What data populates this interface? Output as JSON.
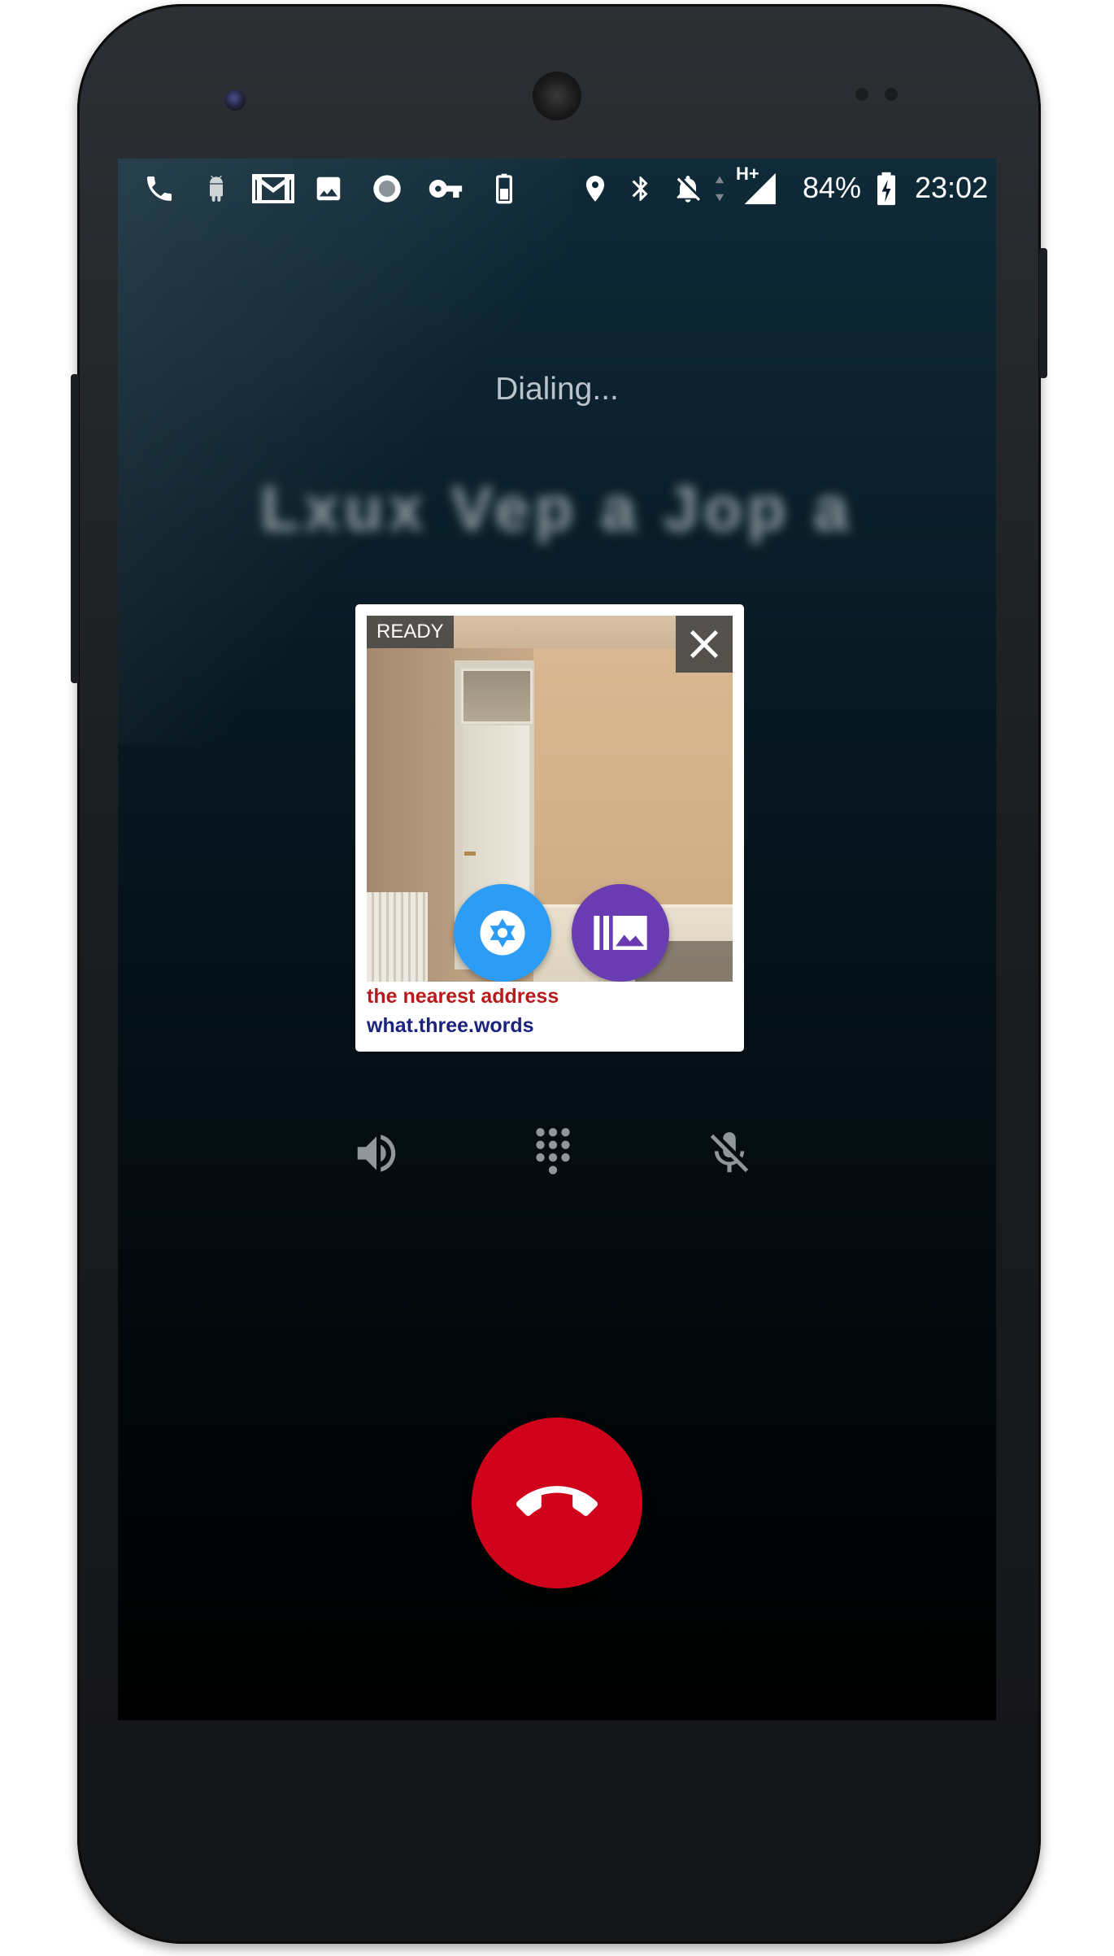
{
  "device": {
    "model": "phone"
  },
  "status_bar": {
    "icons": [
      "phone-icon",
      "android-icon",
      "gmail-icon",
      "image-icon",
      "record-icon",
      "key-icon",
      "battery-saver-icon",
      "location-icon",
      "bluetooth-icon",
      "notifications-off-icon",
      "data-arrows-icon",
      "signal-icon",
      "battery-charging-icon"
    ],
    "network_type": "H+",
    "battery_percent": "84%",
    "time": "23:02"
  },
  "call": {
    "status": "Dialing...",
    "contact_name": "Lxux Vep a Jop a"
  },
  "location_card": {
    "badge": "READY",
    "nearest_address": "the nearest address",
    "what3words": "what.three.words",
    "colors": {
      "address_text": "#b71c1c",
      "w3w_text": "#1a237e",
      "camera_button": "#2c9cf5",
      "gallery_button": "#6a3cb2"
    }
  },
  "call_controls": {
    "buttons": [
      "speaker-icon",
      "dialpad-icon",
      "mute-mic-icon"
    ]
  },
  "end_call": {
    "color": "#d0021b"
  }
}
